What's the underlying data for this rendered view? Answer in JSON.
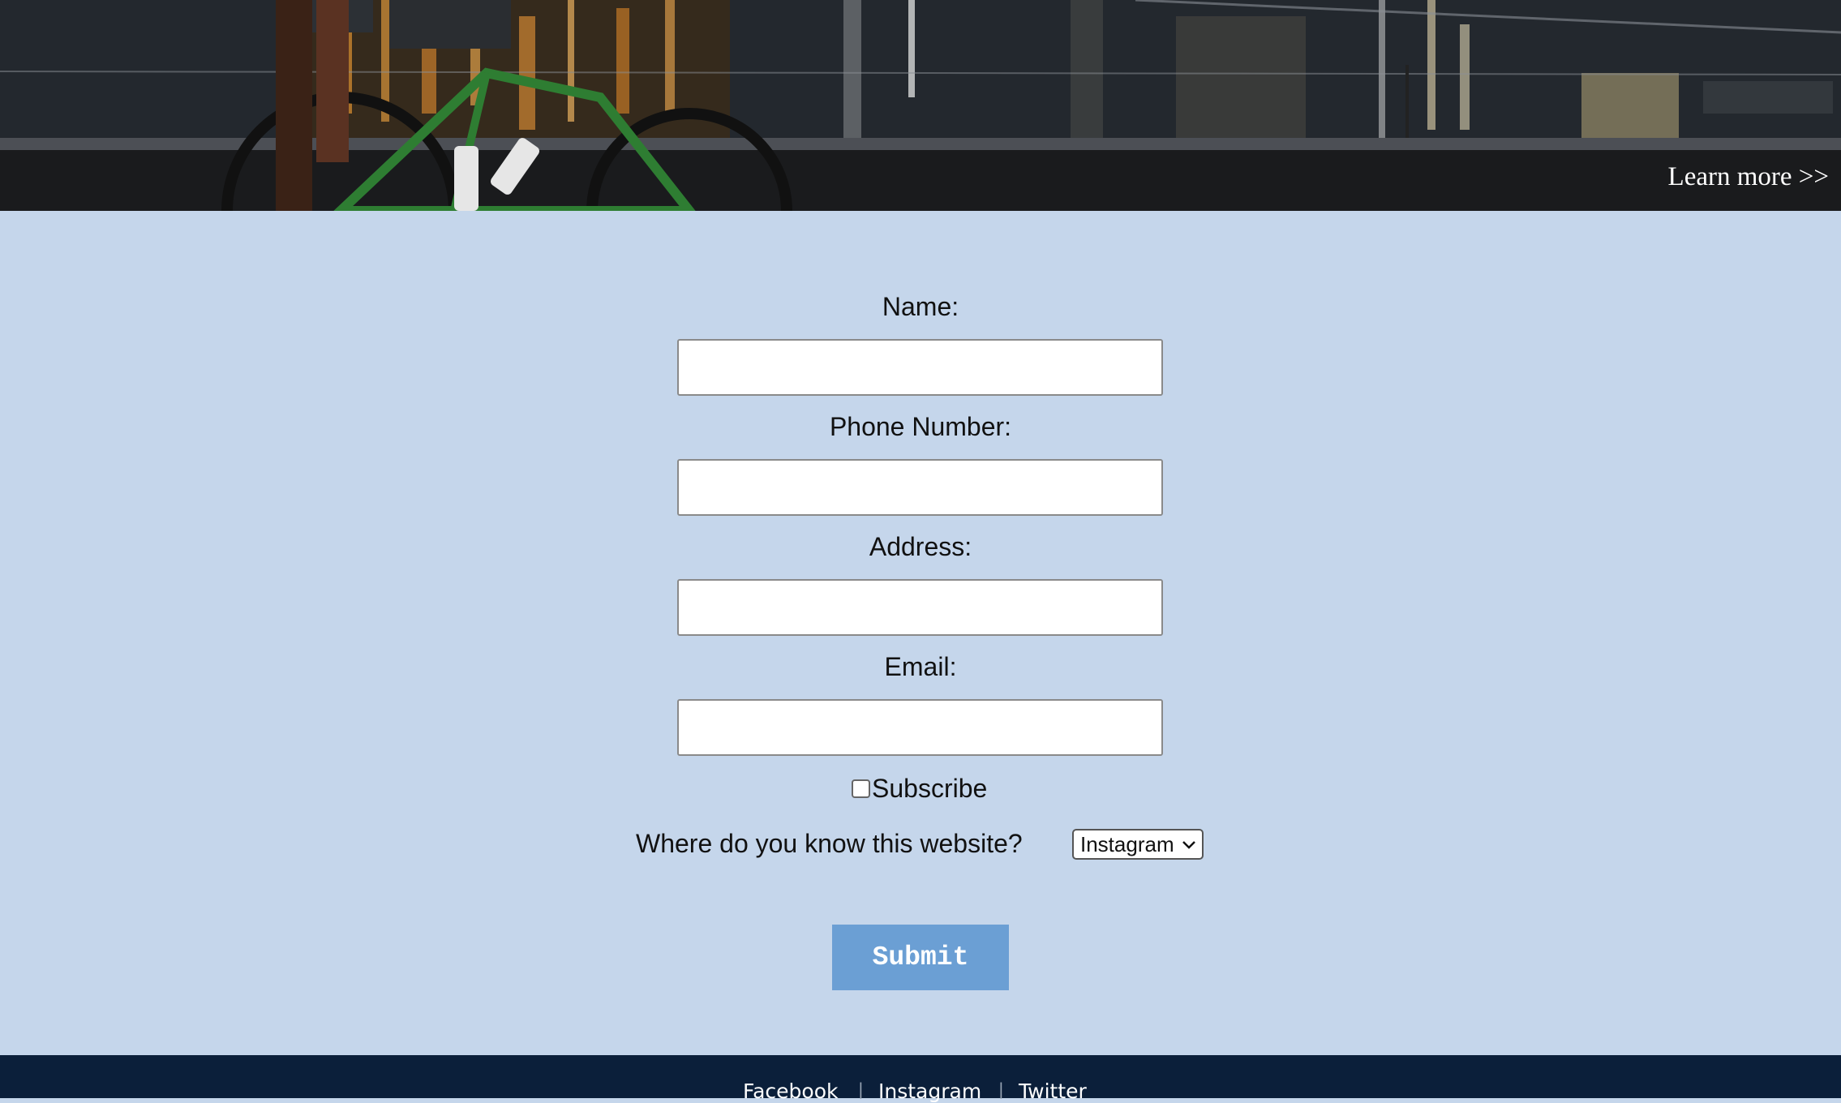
{
  "hero": {
    "learn_more_label": "Learn more >>"
  },
  "form": {
    "name_label": "Name:",
    "phone_label": "Phone Number:",
    "address_label": "Address:",
    "email_label": "Email:",
    "name_value": "",
    "phone_value": "",
    "address_value": "",
    "email_value": "",
    "subscribe_label": "Subscribe",
    "subscribe_checked": false,
    "source_question": "Where do you know this website?",
    "source_selected": "Instagram",
    "submit_label": "Submit"
  },
  "footer": {
    "links": [
      {
        "label": "Facebook"
      },
      {
        "label": "Instagram"
      },
      {
        "label": "Twitter"
      }
    ],
    "separator": "|"
  },
  "colors": {
    "page_background": "#c5d6eb",
    "submit_button": "#6b9fd4",
    "footer_background": "#0b1f3a"
  }
}
